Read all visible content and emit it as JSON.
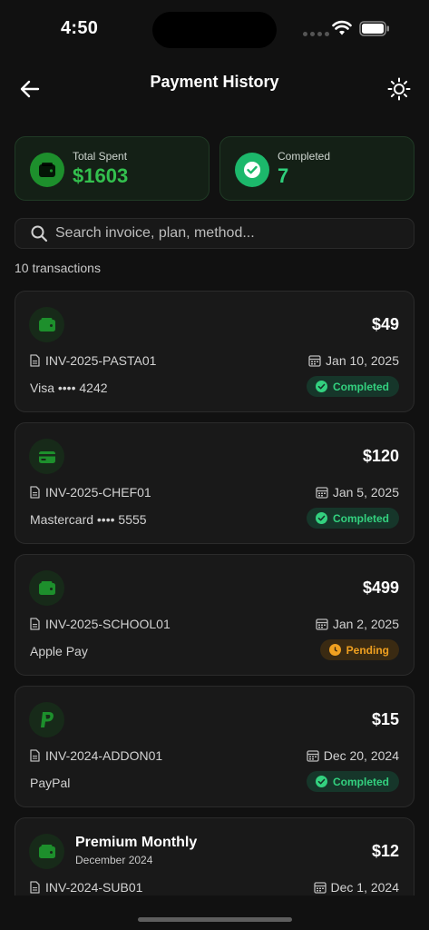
{
  "status_bar": {
    "time": "4:50"
  },
  "header": {
    "title": "Payment History"
  },
  "summary": {
    "total_spent_label": "Total Spent",
    "total_spent_value": "$1603",
    "completed_label": "Completed",
    "completed_value": "7"
  },
  "search": {
    "placeholder": "Search invoice, plan, method..."
  },
  "transactions_count": "10 transactions",
  "transactions": [
    {
      "icon": "wallet-icon",
      "plan": "",
      "period": "",
      "amount": "$49",
      "invoice": "INV-2025-PASTA01",
      "date": "Jan 10, 2025",
      "method": "Visa •••• 4242",
      "status": "Completed"
    },
    {
      "icon": "card-icon",
      "plan": "",
      "period": "",
      "amount": "$120",
      "invoice": "INV-2025-CHEF01",
      "date": "Jan 5, 2025",
      "method": "Mastercard •••• 5555",
      "status": "Completed"
    },
    {
      "icon": "wallet-icon",
      "plan": "",
      "period": "",
      "amount": "$499",
      "invoice": "INV-2025-SCHOOL01",
      "date": "Jan 2, 2025",
      "method": "Apple Pay",
      "status": "Pending"
    },
    {
      "icon": "paypal-icon",
      "plan": "",
      "period": "",
      "amount": "$15",
      "invoice": "INV-2024-ADDON01",
      "date": "Dec 20, 2024",
      "method": "PayPal",
      "status": "Completed"
    },
    {
      "icon": "wallet-icon",
      "plan": "Premium Monthly",
      "period": "December 2024",
      "amount": "$12",
      "invoice": "INV-2024-SUB01",
      "date": "Dec 1, 2024",
      "method": "",
      "status": ""
    }
  ],
  "colors": {
    "background": "#111111",
    "accent_green": "#1d8f2c",
    "completed_green": "#33d17f",
    "pending_orange": "#f0a020"
  }
}
